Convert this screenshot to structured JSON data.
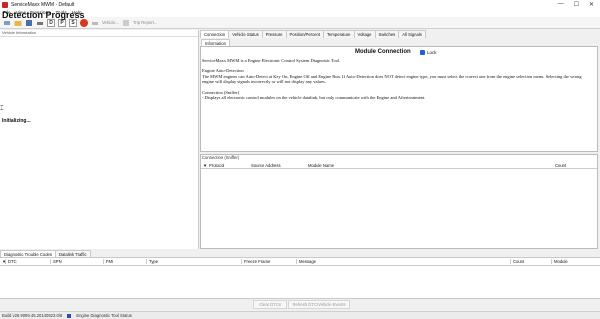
{
  "window": {
    "title": "ServiceMaxx MWM - Default",
    "controls": [
      "—",
      "☐",
      "✕"
    ]
  },
  "menu": [
    "File",
    "View",
    "Sessions",
    "Tools",
    "Help"
  ],
  "toolbar": {
    "buttons": [
      "D",
      "P",
      "S"
    ],
    "vehicle_label": "Vehicle...",
    "trip_label": "Trip Report..."
  },
  "left_panel": {
    "header": "Vehicle Information",
    "heading": "Detection Progress",
    "status": "Initializing..."
  },
  "tabs": [
    "Connection",
    "Vehicle Status",
    "Pressure",
    "Position/Percent",
    "Temperature",
    "Voltage",
    "Switches",
    "All Signals"
  ],
  "info_tab": "Information",
  "module_connection": {
    "title": "Module Connection",
    "lock_label": "Lock",
    "intro": "ServiceMaxx MWM is a Engine Electronic Control System Diagnostic Tool.",
    "auto_title": "Engine Auto-Detection",
    "auto_text": "The MWM engines can Auto-Detect at Key On, Engine Off and Engine Run. If Auto-Detection does NOT detect engine type, you must select the correct one from the engine selection menu. Selecting the wrong engine will display signals incorrectly or will not display any values.",
    "sniffer_title": "Connection (Sniffer)",
    "sniffer_text": "- Displays all electronic control modules on the vehicle datalink, but only communicate with the Engine and Aftertreatment."
  },
  "connection_panel": {
    "label": "Connection (Sniffer)",
    "columns": [
      "Protocol",
      "Source Address",
      "Module Name",
      "Count"
    ]
  },
  "bottom_tabs": [
    "Diagnostic Trouble Codes",
    "Datalink Traffic"
  ],
  "dtc_columns": [
    "DTC",
    "SPN",
    "FMI",
    "Type",
    "Freeze Frame",
    "Message",
    "Count",
    "Module"
  ],
  "buttons": {
    "clear": "Clear DTCs",
    "refresh": "Refresh DTC/Vehicle Events"
  },
  "status": {
    "build": "Build v26.9099.46.20140923.0/8",
    "state": "Engine Diagnostic Tool Status"
  }
}
